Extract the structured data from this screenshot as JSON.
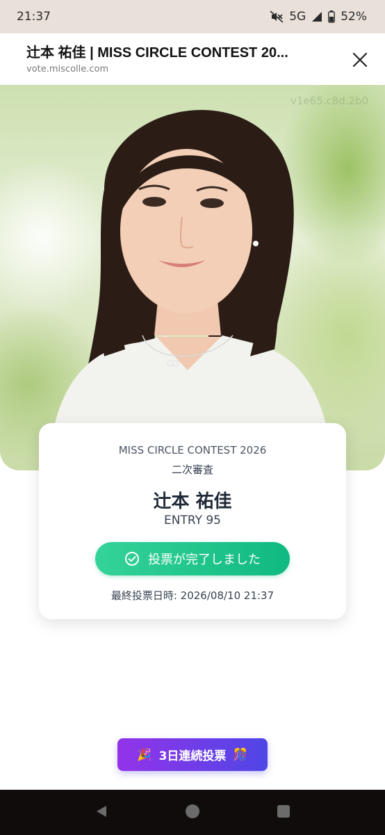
{
  "status_bar": {
    "time": "21:37",
    "network": "5G",
    "battery": "52%",
    "icons": [
      "mute-icon",
      "signal-icon",
      "battery-icon"
    ]
  },
  "browser": {
    "title": "辻本 祐佳 | MISS CIRCLE CONTEST 20...",
    "url": "vote.miscolle.com",
    "close_icon": "close-icon"
  },
  "photo": {
    "watermark": "v1e65.c8d.2b0"
  },
  "card": {
    "contest": "MISS CIRCLE CONTEST 2026",
    "stage": "二次審査",
    "name": "辻本 祐佳",
    "entry": "ENTRY 95",
    "vote_done_label": "投票が完了しました",
    "last_vote": "最終投票日時: 2026/08/10 21:37"
  },
  "streak": {
    "label": "3日連続投票",
    "icon_left": "🎉",
    "icon_right": "🎊"
  },
  "colors": {
    "accent_green": "#10b981",
    "accent_purple": "#9333ea",
    "accent_indigo": "#4f46e5"
  }
}
